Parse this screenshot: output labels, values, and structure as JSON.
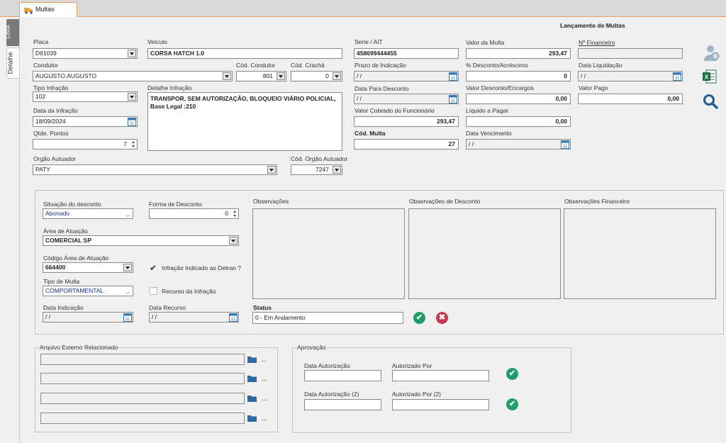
{
  "tab": {
    "title": "Multas"
  },
  "side_tabs": [
    "Lista",
    "Detalhe"
  ],
  "header": {
    "title": "Lançamento de Multas"
  },
  "form": {
    "placa_label": "Placa",
    "placa": "DII1039",
    "veiculo_label": "Veículo",
    "veiculo": "CORSA HATCH 1.0",
    "serie_label": "Serie / AIT",
    "serie": "458699444455",
    "valor_multa_label": "Valor da Multa",
    "valor_multa": "293,47",
    "n_financeiro_label": "Nº Financeiro",
    "n_financeiro": "",
    "condutor_label": "Condutor",
    "condutor": "AUGUSTO.AUGUSTO",
    "cod_condutor_label": "Cód. Condutor",
    "cod_condutor": "801",
    "cod_cracha_label": "Cód. Crachá",
    "cod_cracha": "0",
    "prazo_label": "Prazo de Indicação",
    "prazo": " / /",
    "desconto_pct_label": "% Desconto/Acréscimo",
    "desconto_pct": "0",
    "data_liquidacao_label": "Data Liquidação",
    "data_liquidacao": " / /",
    "tipo_infracao_label": "Tipo Infração",
    "tipo_infracao": "102",
    "detalhe_infracao_label": "Detalhe  Infração",
    "detalhe_infracao": "TRANSPOR, SEM AUTORIZAÇÃO, BLOQUEIO VIÁRIO POLICIAL, Base Legal :210",
    "data_desconto_label": "Data Para Desconto",
    "data_desconto": " / /",
    "valor_desconto_label": "Valor Desconto/Encargos",
    "valor_desconto": "0,00",
    "valor_pago_label": "Valor Pago",
    "valor_pago": "0,00",
    "data_infracao_label": "Data da Infração",
    "data_infracao": "18/09/2024",
    "valor_cobrado_label": "Valor Cobrado do Funcionário",
    "valor_cobrado": "293,47",
    "liquido_label": "Líquido a Pagar",
    "liquido": "0,00",
    "qtde_pontos_label": "Qtde. Pontos",
    "qtde_pontos": "7",
    "cod_multa_label": "Cód. Multa",
    "cod_multa": "27",
    "data_vencimento_label": "Data Vencimento",
    "data_vencimento": " / /",
    "orgao_label": "Orgão Autuador",
    "orgao": "PATY",
    "cod_orgao_label": "Cód. Orgão Autuador",
    "cod_orgao": "7247"
  },
  "detail": {
    "situacao_label": "Situação do desconto",
    "situacao": "Abonado",
    "forma_label": "Forma de Desconto",
    "forma": "0",
    "area_label": "Área de Atuação",
    "area": "COMERCIAL SP",
    "cod_area_label": "Código Área de Atuação",
    "cod_area": "664400",
    "infracao_detran_label": "Infração Indicado ao Detran ?",
    "tipo_multa_label": "Tipo de Multa",
    "tipo_multa": "COMPORTAMENTAL",
    "recurso_label": "Recurso da Infração",
    "data_indicacao_label": "Data Indicação",
    "data_indicacao": " / /",
    "data_recurso_label": "Data Recurso",
    "data_recurso": " / /",
    "observacoes_label": "Observações",
    "obs_desconto_label": "Observações de Desconto",
    "obs_financeiro_label": "Observações Financeiro",
    "status_label": "Status",
    "status": "0 - Em Andamento"
  },
  "arquivo": {
    "title": "Arquivo Externo Relacionado",
    "dots": "..."
  },
  "aprovacao": {
    "title": "Aprovação",
    "data_aut_label": "Data Autorização",
    "aut_por_label": "Autorizado Por",
    "data_aut2_label": "Data Autorização (2)",
    "aut_por2_label": "Autorizado Por (2)"
  },
  "colors": {
    "accent": "#1f9e6b",
    "danger": "#c9384f",
    "tab_border": "#f0a060",
    "excel": "#1d7044",
    "search": "#1f5d96"
  }
}
